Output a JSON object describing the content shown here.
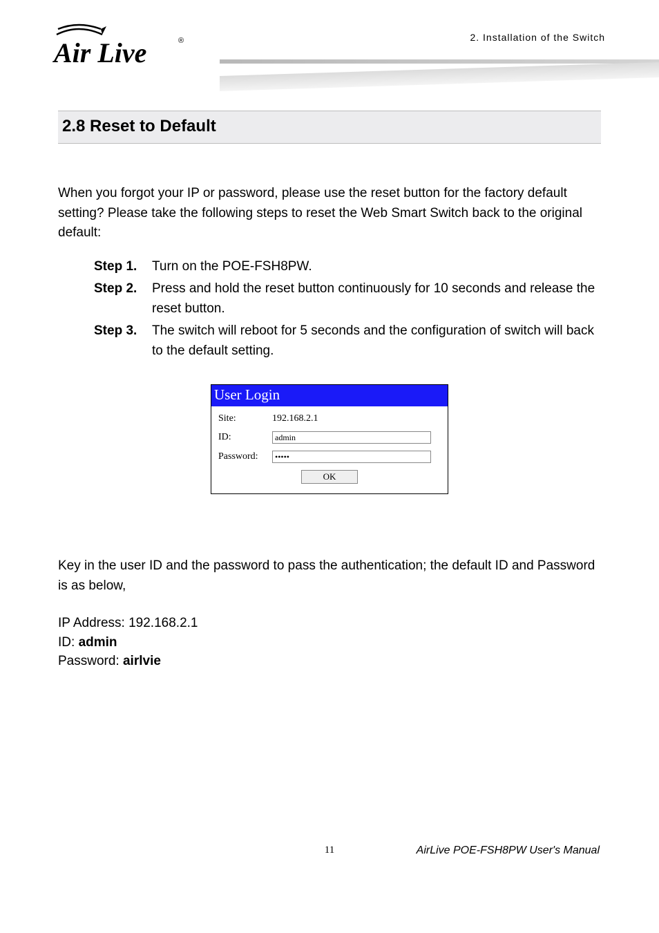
{
  "header": {
    "breadcrumb": "2. Installation of the Switch",
    "logo_text_top": "Air Live",
    "logo_trademark": "®"
  },
  "section": {
    "heading": "2.8 Reset to Default",
    "intro": "When you forgot your IP or password, please use the reset button for the factory default setting? Please take the following steps to reset the Web Smart Switch back to the original default:",
    "steps": [
      {
        "label": "Step 1.",
        "text": "Turn on the POE-FSH8PW."
      },
      {
        "label": "Step 2.",
        "text": "Press and hold the reset button continuously for 10 seconds and release the reset button."
      },
      {
        "label": "Step 3.",
        "text": "The switch will reboot for 5 seconds and the configuration of switch will back to the default setting."
      }
    ]
  },
  "login_box": {
    "title": "User Login",
    "site_label": "Site:",
    "site_value": "192.168.2.1",
    "id_label": "ID:",
    "id_value": "admin",
    "password_label": "Password:",
    "password_value": "•••••",
    "ok_label": "OK"
  },
  "credentials": {
    "intro": "Key in the user ID and the password to pass the authentication; the default ID and Password is as below,",
    "ip_label": "IP Address: ",
    "ip_value": "192.168.2.1",
    "id_label": "ID: ",
    "id_value": "admin",
    "pw_label": "Password: ",
    "pw_value": "airlvie"
  },
  "footer": {
    "page_number": "11",
    "manual": "AirLive POE-FSH8PW User's Manual"
  }
}
